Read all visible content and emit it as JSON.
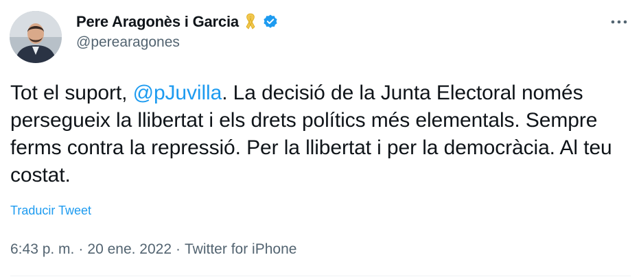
{
  "author": {
    "display_name": "Pere Aragonès i Garcia",
    "handle": "@perearagones"
  },
  "tweet": {
    "text_before": "Tot el suport, ",
    "mention": "@pJuvilla",
    "text_after": ". La decisió de la Junta Electoral només persegueix la llibertat i els drets polítics més elementals. Sempre ferms contra la repressió. Per la llibertat i per la democràcia. Al teu costat.",
    "translate_label": "Traducir Tweet"
  },
  "meta": {
    "time": "6:43 p. m.",
    "sep1": "·",
    "date": "20 ene. 2022",
    "sep2": "·",
    "source": "Twitter for iPhone"
  },
  "colors": {
    "accent": "#1d9bf0",
    "secondary_text": "#536471",
    "ribbon": "#f2c74e"
  },
  "icons": {
    "ribbon": "yellow-ribbon-icon",
    "verified": "verified-badge-icon",
    "more": "more-options-icon"
  }
}
